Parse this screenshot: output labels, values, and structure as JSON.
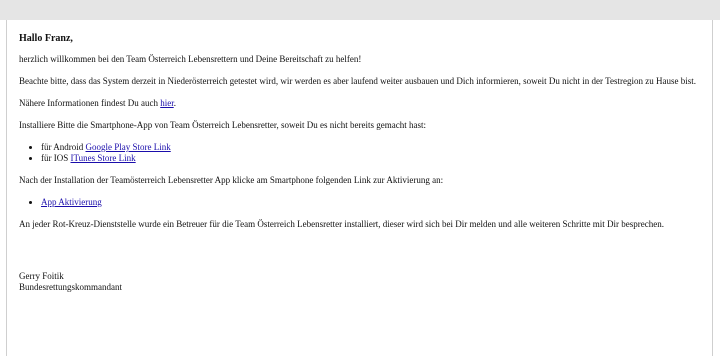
{
  "email": {
    "greeting": "Hallo Franz,",
    "welcome": "herzlich willkommen bei den Team Österreich Lebensrettern und Deine Bereitschaft zu helfen!",
    "info_testing": "Beachte bitte, dass das System derzeit in Niederösterreich getestet wird, wir werden es aber laufend weiter ausbauen und Dich informieren, soweit Du nicht in der Testregion zu Hause bist.",
    "more_info_prefix": "Nähere Informationen findest Du auch ",
    "more_info_link": "hier",
    "more_info_suffix": ".",
    "install_intro": "Installiere Bitte die Smartphone-App von Team Österreich Lebensretter, soweit Du es nicht bereits gemacht hast:",
    "app_links": [
      {
        "prefix": "für Android ",
        "link": "Google Play Store Link"
      },
      {
        "prefix": "für IOS ",
        "link": "ITunes Store Link"
      }
    ],
    "activation_intro": "Nach der Installation der Teamösterreich Lebensretter App klicke am Smartphone folgenden Link zur Aktivierung an:",
    "activation_link": "App Aktivierung",
    "supervisor_note": "An jeder Rot-Kreuz-Dienststelle wurde ein Betreuer für die Team Österreich Lebensretter installiert, dieser wird sich bei Dir melden und alle weiteren Schritte mit Dir besprechen.",
    "signature": {
      "name": "Gerry Foitik",
      "role": "Bundesrettungskommandant"
    }
  },
  "colors": {
    "link": "#1a0dab",
    "text": "#111111",
    "topbar": "#e5e5e5"
  }
}
